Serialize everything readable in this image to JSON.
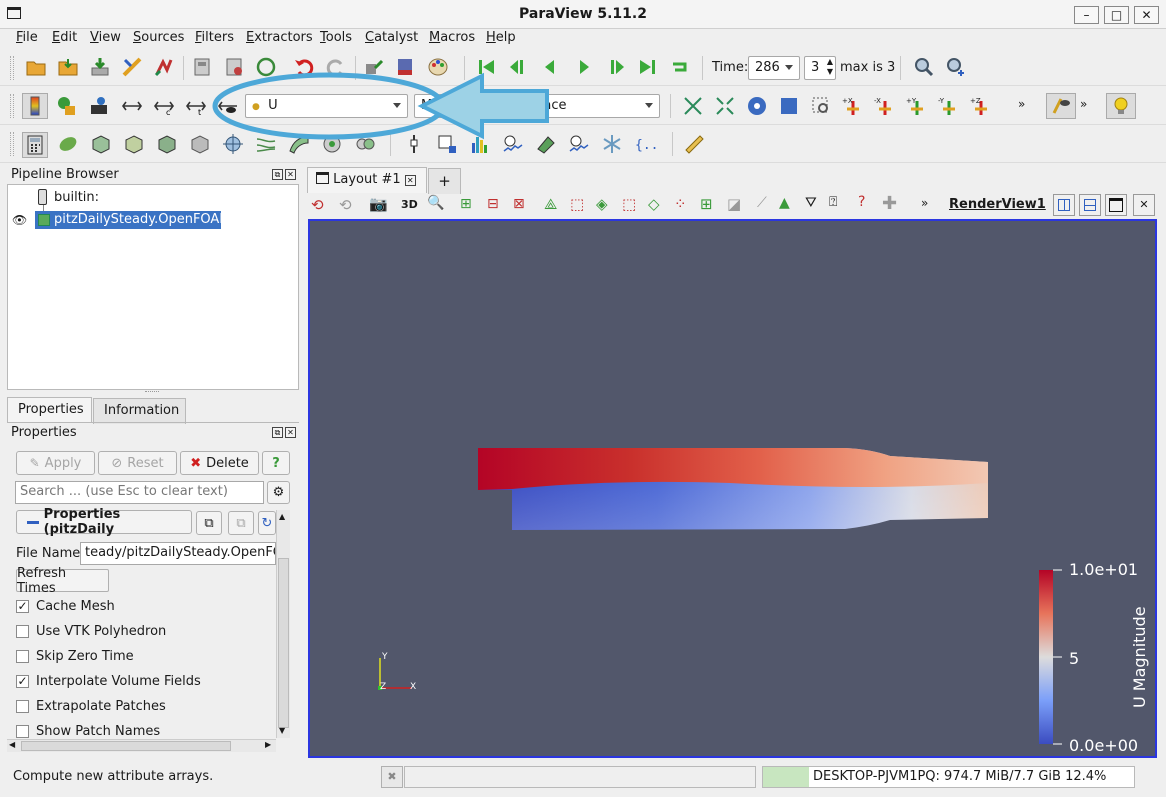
{
  "window": {
    "title": "ParaView 5.11.2",
    "controls": [
      "–",
      "□",
      "✕"
    ]
  },
  "menu": [
    "File",
    "Edit",
    "View",
    "Sources",
    "Filters",
    "Extractors",
    "Tools",
    "Catalyst",
    "Macros",
    "Help"
  ],
  "time": {
    "label": "Time:",
    "value": "286",
    "index": "3",
    "max_label": "max is 3"
  },
  "color_array": {
    "selected": "U",
    "component": "Magnitude",
    "representation": "Surface"
  },
  "pipeline": {
    "title": "Pipeline Browser",
    "items": [
      {
        "label": "builtin:"
      },
      {
        "label": "pitzDailySteady.OpenFOAM"
      }
    ]
  },
  "tabs": {
    "properties": "Properties",
    "information": "Information"
  },
  "properties": {
    "title": "Properties",
    "apply": "Apply",
    "reset": "Reset",
    "delete": "Delete",
    "help": "?",
    "search_placeholder": "Search ... (use Esc to clear text)",
    "section_label": "Properties (pitzDaily",
    "file_name_label": "File Name",
    "file_name_value": "teady/pitzDailySteady.OpenFOAM",
    "refresh_times": "Refresh Times",
    "checkboxes": [
      {
        "label": "Cache Mesh",
        "checked": "✓"
      },
      {
        "label": "Use VTK Polyhedron",
        "checked": ""
      },
      {
        "label": "Skip Zero Time",
        "checked": ""
      },
      {
        "label": "Interpolate Volume Fields",
        "checked": "✓"
      },
      {
        "label": "Extrapolate Patches",
        "checked": ""
      },
      {
        "label": "Show Patch Names",
        "checked": ""
      }
    ]
  },
  "layout": {
    "tab_label": "Layout #1",
    "add_tab": "+",
    "view_name": "RenderView1",
    "btn_3d": "3D"
  },
  "colorbar": {
    "title": "U Magnitude",
    "max_label": "1.0e+01",
    "mid_label": "5",
    "min_label": "0.0e+00"
  },
  "axes": {
    "y": "Y",
    "z": "Z",
    "x": "X"
  },
  "status": {
    "message": "Compute new attribute arrays.",
    "memory": "DESKTOP-PJVM1PQ: 974.7 MiB/7.7 GiB 12.4%"
  },
  "colors": {
    "background": "#52576b",
    "view_border": "#2b36e0",
    "high": "#b40426",
    "low": "#3b4cc0",
    "selection": "#3a73c4",
    "annotation": "#4da8d8"
  }
}
